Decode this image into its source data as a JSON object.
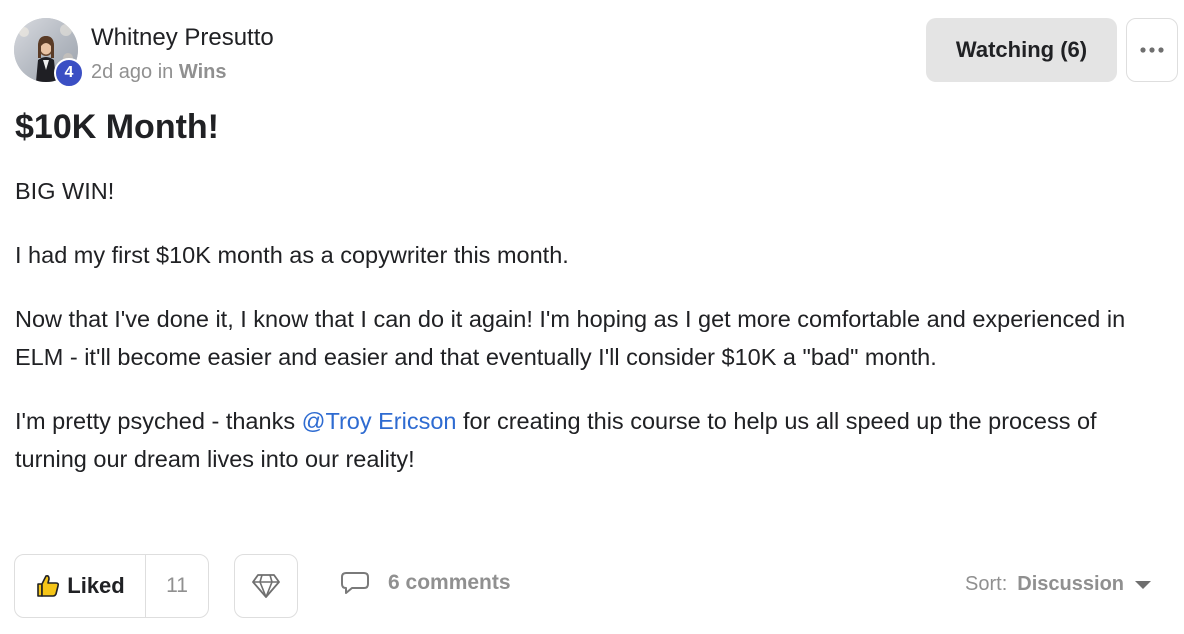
{
  "author": {
    "name": "Whitney Presutto",
    "level": "4",
    "time_ago": "2d ago",
    "in_word": "in",
    "category": "Wins"
  },
  "actions": {
    "watch_label": "Watching (6)",
    "more_icon": "ellipsis-icon"
  },
  "post": {
    "title": "$10K Month!",
    "paragraphs": [
      "BIG WIN!",
      "I had my first $10K month as a copywriter this month.",
      "Now that I've done it, I know that I can do it again! I'm hoping as I get more comfortable and experienced in ELM - it'll become easier and easier and that eventually I'll consider $10K a \"bad\" month."
    ],
    "last_paragraph": {
      "before": "I'm pretty psyched - thanks ",
      "mention": "@Troy Ericson",
      "after": " for creating this course to help us all speed up the process of turning our dream lives into our reality!"
    },
    "mention_color": "#2e6bd1"
  },
  "footer": {
    "like_label": "Liked",
    "like_count": "11",
    "like_icon": "thumbs-up-icon",
    "gem_icon": "diamond-icon",
    "comments_icon": "speech-bubble-icon",
    "comments_label": "6 comments",
    "sort_prefix": "Sort:",
    "sort_value": "Discussion"
  },
  "colors": {
    "badge": "#3b4fc4",
    "like_thumb": "#f5c518",
    "muted": "#909090"
  }
}
